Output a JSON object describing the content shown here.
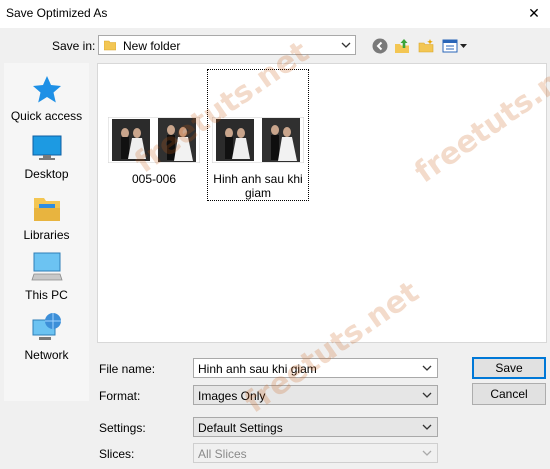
{
  "window": {
    "title": "Save Optimized As",
    "close_glyph": "✕"
  },
  "save_in": {
    "label": "Save in:",
    "value": "New folder"
  },
  "places": [
    {
      "label": "Quick access",
      "icon": "star-icon"
    },
    {
      "label": "Desktop",
      "icon": "desktop-icon"
    },
    {
      "label": "Libraries",
      "icon": "libraries-icon"
    },
    {
      "label": "This PC",
      "icon": "computer-icon"
    },
    {
      "label": "Network",
      "icon": "network-icon"
    }
  ],
  "files": [
    {
      "name": "005-006",
      "selected": false
    },
    {
      "name": "Hinh anh sau khi giam",
      "selected": true
    }
  ],
  "fields": {
    "file_name": {
      "label": "File name:",
      "value": "Hinh anh sau khi giam"
    },
    "format": {
      "label": "Format:",
      "value": "Images Only"
    },
    "settings": {
      "label": "Settings:",
      "value": "Default Settings"
    },
    "slices": {
      "label": "Slices:",
      "value": "All Slices"
    }
  },
  "buttons": {
    "save": "Save",
    "cancel": "Cancel"
  },
  "watermark": "freetuts.net",
  "colors": {
    "accent": "#0078d7",
    "folder": "#f3c653",
    "star": "#1e90e6"
  }
}
